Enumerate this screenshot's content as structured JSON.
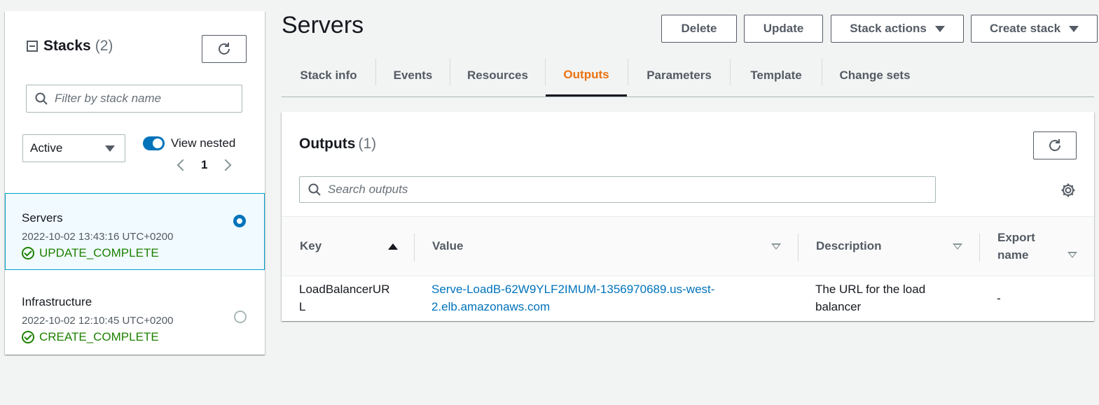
{
  "sidebar": {
    "title": "Stacks",
    "count": "(2)",
    "filter_placeholder": "Filter by stack name",
    "status_filter": "Active",
    "view_nested_label": "View nested",
    "page": "1",
    "stacks": [
      {
        "name": "Servers",
        "date": "2022-10-02 13:43:16 UTC+0200",
        "status": "UPDATE_COMPLETE",
        "selected": true
      },
      {
        "name": "Infrastructure",
        "date": "2022-10-02 12:10:45 UTC+0200",
        "status": "CREATE_COMPLETE",
        "selected": false
      }
    ]
  },
  "header": {
    "title": "Servers",
    "buttons": {
      "delete": "Delete",
      "update": "Update",
      "stack_actions": "Stack actions",
      "create_stack": "Create stack"
    }
  },
  "tabs": [
    "Stack info",
    "Events",
    "Resources",
    "Outputs",
    "Parameters",
    "Template",
    "Change sets"
  ],
  "active_tab": "Outputs",
  "outputs": {
    "title": "Outputs",
    "count": "(1)",
    "search_placeholder": "Search outputs",
    "columns": [
      "Key",
      "Value",
      "Description",
      "Export name"
    ],
    "rows": [
      {
        "key_line1": "LoadBalancerUR",
        "key_line2": "L",
        "value_line1": "Serve-LoadB-62W9YLF2IMUM-1356970689.us-west-",
        "value_line2": "2.elb.amazonaws.com",
        "description_line1": "The URL for the load",
        "description_line2": "balancer",
        "export_name": "-"
      }
    ]
  },
  "colors": {
    "accent": "#ec7211",
    "link": "#0073bb",
    "success": "#1d8102",
    "selected_bg": "#f1faff",
    "selected_border": "#00a1c9"
  },
  "icons": [
    "refresh-icon",
    "search-icon",
    "collapse-icon",
    "caret-down-icon",
    "chevron-left-icon",
    "chevron-right-icon",
    "success-icon",
    "gear-icon",
    "sort-ascending-icon",
    "sort-icon"
  ]
}
